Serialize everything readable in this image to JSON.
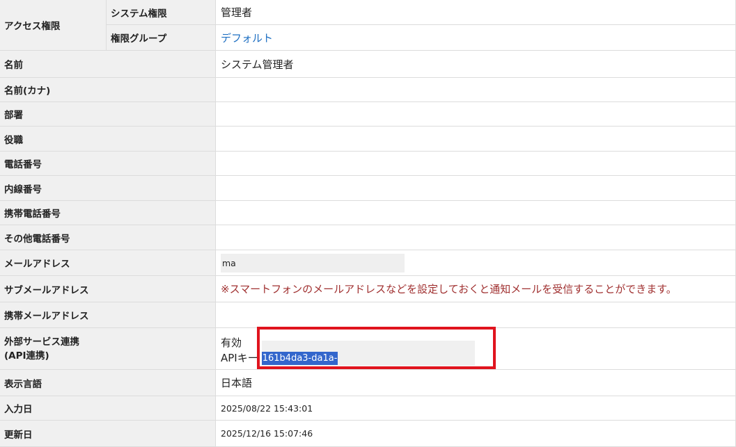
{
  "access": {
    "group_label": "アクセス権限",
    "system_role_label": "システム権限",
    "system_role_value": "管理者",
    "role_group_label": "権限グループ",
    "role_group_value": "デフォルト"
  },
  "fields": {
    "name_label": "名前",
    "name_value": "システム管理者",
    "name_kana_label": "名前(カナ)",
    "department_label": "部署",
    "position_label": "役職",
    "phone_label": "電話番号",
    "extension_label": "内線番号",
    "mobile_label": "携帯電話番号",
    "other_phone_label": "その他電話番号",
    "email_label": "メールアドレス",
    "email_value": "ma",
    "sub_email_label": "サブメールアドレス",
    "sub_email_notice": "※スマートフォンのメールアドレスなどを設定しておくと通知メールを受信することができます。",
    "mobile_email_label": "携帯メールアドレス",
    "external_label_line1": "外部サービス連携",
    "external_label_line2": "(API連携)",
    "external_status": "有効",
    "api_key_label": "APIキー",
    "api_key_value": "161b4da3-da1a-",
    "language_label": "表示言語",
    "language_value": "日本語",
    "created_label": "入力日",
    "created_value": "2025/08/22 15:43:01",
    "updated_label": "更新日",
    "updated_value": "2025/12/16 15:07:46"
  },
  "colors": {
    "label_bg": "#f0f0f0",
    "link": "#1e6fc2",
    "notice": "#a03030",
    "selection": "#3366cc",
    "highlight_border": "#e0141e"
  }
}
